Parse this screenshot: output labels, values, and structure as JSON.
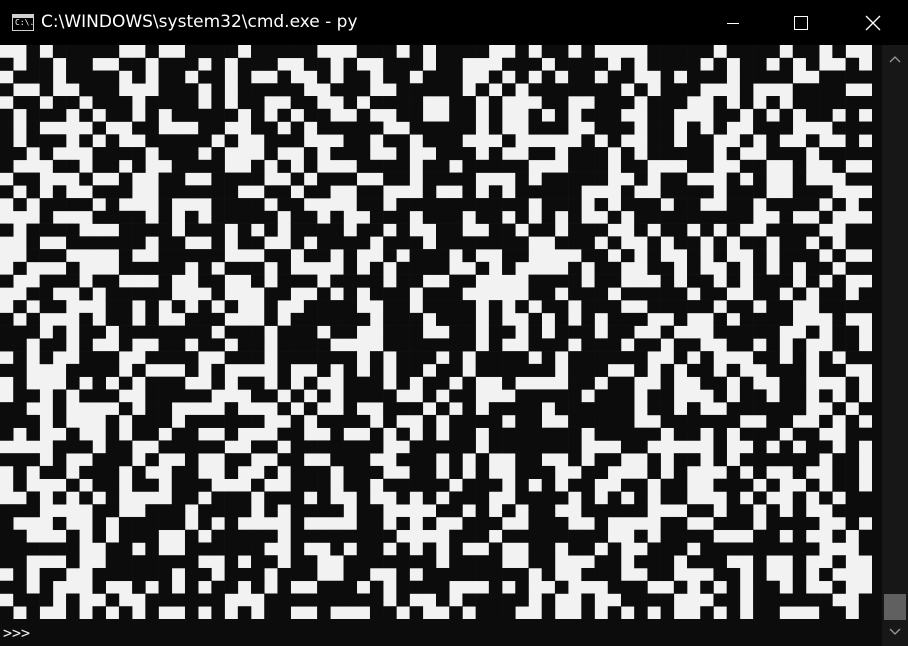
{
  "window": {
    "title": "C:\\WINDOWS\\system32\\cmd.exe - py",
    "icon_label": "C:\\.",
    "controls": [
      "minimize",
      "maximize",
      "close"
    ]
  },
  "console": {
    "prompt": ">>>",
    "foreground": "#0c0c0c",
    "background": "#f2f2f2",
    "pattern": [
      "  X XXXXX  X  XXXX XXXXX   XXX X XXXX  X XX X    XXXXX XXXX XX X  ",
      "X XX XX  XX XXX X XXX  XX X  XXX XX   XXX XXXX X XXXX X XX X X  X ",
      " XXX XXXX X XX XX X  X  X XX XX XXX  X X X XX XX  X XXX XXXX  XXXX",
      "X  X  XXX   XXX X XXXXX  XXX  XXXXX X X XXXXXXX X XXX   X   XXXX  ",
      " XX XX XXX XXXX X XX  XX  X XXXX  XX X   XX  XXX XXX  X X X XXXXXX",
      "X XXX X XX X XXXXX X X XX  X  XX  XX X  X X XXX  XX   XX X X XX X ",
      "X X    X  XX   XX  XX X XXXXX  XXXXX X  XXX  XXX XX X X  XXX   XXX",
      "X XXX X X  XXXXX X  XXX   XX XX XXX   X     X X  XX XX  X X  X  X ",
      "XX X   XXXX XXX X   X  X XXX  X  XXX X  XX XXX X XXXXX X  XXX XXXX",
      "X   XX XX X  XXXX  X X X   XXXX XX XXXXX   XXX XX   XX  XX  X  X  ",
      " XX   X  X  XX  XXXX  X XXX  XX XXXX   X XXXXX  X XX   X X  X   XX",
      "X X X  XXX  XXXXXX  XX XX  XX   X  X X XXXXX   X  XXXX XXX  XXX   ",
      " X XXXX X   X   XXXX XX    XX XXXXXXXXXX XXX X XXX XX  XX XXXX X X",
      "   X   XXXX X X XXXXX XX X  XXX XXX XX X X X  X XXXXXXXXX  X  X   ",
      "X XXXX   XXXX XXX X X XXXX XX X  XX  XX XX XXX  X XX X X  XXXX  XX",
      "  X  XXXXXX XX  X XX  X XXXX XXX XXXXXXX  XXX X  X XX X XX XX X XX",
      "  XXX    X  XXXXX   XX XX X  X XXX X  XX    XX X X  X X  X XXX X  ",
      " X   X   XXXXX X XXX X    X X XXXX  X X    X XX  XX X  X X X XX XX",
      "X  XXX XX   X  XX  X XXX XXXX XX  XX    XXXX XX   X XX X XXX X X  ",
      "  XX  X XXXXX   X   XX  X X XXX XXX     XX XXX XXXXX XX  XX X XX X",
      " X XX   XX X X X X  X  XXXX  XX XXXX X X XX XXX  XXXXX XX XX  XXXX",
      "X X   X XX X  XXX   X XXXXXX XXX XXX X  X X X XXX  X  X XXXX   X  ",
      "XXX X XX XXXXXXX XXX XXX XX  XXX  XX XX X XXX XX  X   XXXXX  X XX ",
      "XX XX X  X  XX XX XX XXXX    XXXXXXX X  XXX XXX XX XX  XX X X  XX ",
      " X X  XXX  XXXX  XXX XXXXXX X XXX X XXXX X XXXXXX  X X   XX X X XX",
      "XX   XXXX X   X X    X  X X X XX XX XXXXXX XXX  X X XX X  XXX XX  ",
      " X   X X X XXX  X XX X X  XXX X XX X  X    XX XX  X  XX X  XX   X ",
      " XX X XXX  XXXXX   XX X X XXXX  X XX   XXXXX XXX XX   X XX XX X X ",
      "XX  X    X XX    X   X X  X  XXX X X XXXX XXXXXX XX X  XXXXXX  X X",
      "XXX X   X XXX XXXXXX  X XXXX X  X XXXX XX  XXXXX  XXXXXX  XX  X X ",
      "X X  X  X XX XX  X   XX  X  X X X XX XXXXXXX XXXXX XX X XXX XX  XX",
      "    XXX XX  XXXXX  XX XXXXXXX  XXXXX XXXXXXX   XX     X  X X XX X ",
      "XXX X  XXX X  X  XX  XX  XXX  XXX X X  XX  X XX  X XX X XXXXXX XX ",
      " X XX XXX X  XX  X  X XXX XXX  XX X X  XXX  XX   X X   X X  X  XX ",
      " X   X XX XX XXX   X  XXX XX XXXXX XXX X X XX  XX XX  XXX X  X XX ",
      "  X X X X    XX XXX XXX X  X  X X XXX  XXXX X X X XX   X X  X X XX",
      "XXX    XX  XXX XXXX X XXXX XX    XX X X XX  XXXXX   XX XX X X  XXX",
      "X   X  X XXXXX X X    X    XX X X  XXX  XXX  X    XX  XXX XXXX  X ",
      "XX   X X XXX  X XXXXX XXXXXXXX    XXX XXXXXXXX  X XXXX   XX X  X X",
      "XXXXXX  XX X  XXXXXX  X  X XX X X X  X  XX XX X  XXX XXXXXXXXX   X",
      "XX   X  XXXXXXX  X XX XX  XXXXXXX XXXX  XX   XX XXX XXX  X  X  X  ",
      " X XX  XXXXXX XX XXX XXX  XX  X XXXXXXXX X  XXX  XX   XX X  X X   ",
      "XX X   X  X X X XX X X  XXX X XXXX   X X  X   XXX  X X X XX X  X  ",
      " XXX X  X  XXXXXX   XXXXXXXXX X  X XXXXX X  X  XXXX   XX XXXXXX  X",
      "X X  X X X X  X X X XX  X   XX X  X XXX  X  X X X X  X X XX   XX X"
    ]
  }
}
